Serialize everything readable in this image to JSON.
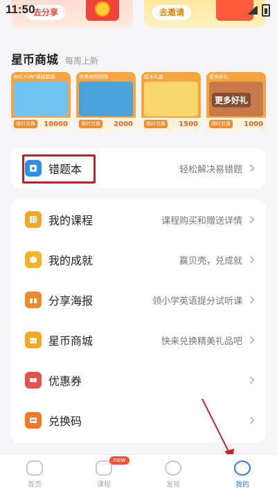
{
  "status": {
    "time": "11:50"
  },
  "banners": {
    "share_label": "去分享",
    "invite_label": "去邀请"
  },
  "mall": {
    "title": "星币商城",
    "subtitle": "每周上新",
    "items": [
      {
        "caption": "BIG FUN!课程套装",
        "price": "10000",
        "tag": "限时兑换"
      },
      {
        "caption": "世界地图拼图",
        "price": "2000",
        "tag": "限时兑换"
      },
      {
        "caption": "绘本礼盒",
        "price": "1500",
        "tag": "限时兑换"
      },
      {
        "caption": "更多好礼",
        "price": "1000",
        "tag": "限时兑换",
        "more_label": "更多好礼"
      }
    ]
  },
  "mistake_book": {
    "label": "错题本",
    "desc": "轻松解决易错题"
  },
  "menu": [
    {
      "label": "我的课程",
      "desc": "课程购买和赠送详情",
      "icon": "course-icon",
      "color": "#f4a62a"
    },
    {
      "label": "我的成就",
      "desc": "赢贝壳，兑成就",
      "icon": "achievement-icon",
      "color": "#f4b42a"
    },
    {
      "label": "分享海报",
      "desc": "领小学英语提分试听课",
      "icon": "gift-icon",
      "color": "#f28a2a"
    },
    {
      "label": "星币商城",
      "desc": "快来兑换精美礼品吧",
      "icon": "store-icon",
      "color": "#f6a623"
    },
    {
      "label": "优惠券",
      "desc": "",
      "icon": "coupon-icon",
      "color": "#e2544a"
    },
    {
      "label": "兑换码",
      "desc": "",
      "icon": "redeem-code-icon",
      "color": "#f07a2a"
    }
  ],
  "tabs": [
    {
      "label": "首页",
      "active": false
    },
    {
      "label": "课程",
      "active": false,
      "badge": "new"
    },
    {
      "label": "发现",
      "active": false
    },
    {
      "label": "我的",
      "active": true
    }
  ],
  "colors": {
    "accent": "#2e7bd6",
    "highlight": "#b8232a"
  }
}
